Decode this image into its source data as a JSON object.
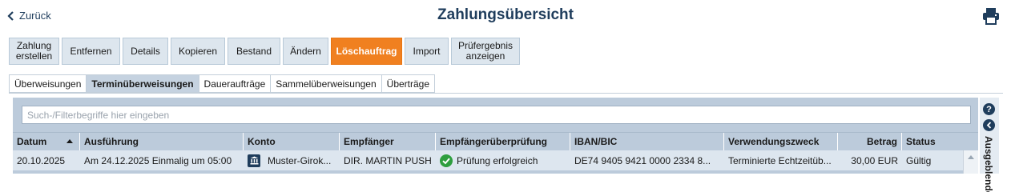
{
  "header": {
    "back_label": "Zurück",
    "title": "Zahlungsübersicht",
    "print_icon": "printer-icon"
  },
  "toolbar": {
    "buttons": [
      {
        "label": "Zahlung erstellen"
      },
      {
        "label": "Entfernen"
      },
      {
        "label": "Details"
      },
      {
        "label": "Kopieren"
      },
      {
        "label": "Bestand"
      },
      {
        "label": "Ändern"
      },
      {
        "label": "Löschauftrag",
        "active": true
      },
      {
        "label": "Import"
      },
      {
        "label": "Prüfergebnis anzeigen"
      }
    ]
  },
  "tabs": [
    {
      "label": "Überweisungen"
    },
    {
      "label": "Terminüberweisungen",
      "active": true
    },
    {
      "label": "Daueraufträge"
    },
    {
      "label": "Sammelüberweisungen"
    },
    {
      "label": "Überträge"
    }
  ],
  "filter": {
    "placeholder": "Such-/Filterbegriffe hier eingeben",
    "value": ""
  },
  "table": {
    "columns": [
      "Datum",
      "Ausführung",
      "Konto",
      "Empfänger",
      "Empfängerüberprüfung",
      "IBAN/BIC",
      "Verwendungszweck",
      "Betrag",
      "Status"
    ],
    "sorted_column": "Datum",
    "sort_direction": "ascending",
    "rows": [
      {
        "datum": "20.10.2025",
        "ausfuehrung": "Am 24.12.2025 Einmalig um 05:00",
        "konto": "Muster-Girok...",
        "empfaenger": "DIR. MARTIN PUSH",
        "empfaengerueberpruefung": "Prüfung erfolgreich",
        "iban_bic": "DE74 9405 9421 0000 2334 8...",
        "verwendungszweck": "Terminierte Echtzeitüb...",
        "betrag": "30,00 EUR",
        "status": "Gültig"
      }
    ]
  },
  "side_panel": {
    "help_label": "?",
    "label": "Ausgeblendet"
  },
  "colors": {
    "accent": "#f08020",
    "title": "#1f3d5c",
    "panel": "#bccbdb",
    "success": "#2e9e3e"
  }
}
